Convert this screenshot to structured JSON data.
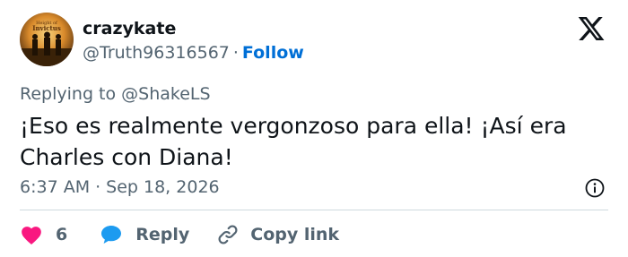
{
  "author": {
    "display_name": "crazykate",
    "handle": "@Truth96316567",
    "separator": "·",
    "follow_label": "Follow",
    "avatar_text": "Height of Invictus"
  },
  "reply_context": "Replying to @ShakeLS",
  "tweet": {
    "text": "¡Eso es realmente vergonzoso para ella! ¡Así era Charles con Diana!",
    "time": "6:37 AM",
    "separator": "·",
    "date": "Sep 18, 2026"
  },
  "actions": {
    "like_count": "6",
    "reply_label": "Reply",
    "copy_label": "Copy link"
  },
  "colors": {
    "text": "#0f1419",
    "secondary": "#536471",
    "follow": "#006fd6",
    "heart": "#f91880",
    "reply_bubble": "#1d9bf0",
    "divider": "#cfd9de"
  },
  "icons": [
    "x-logo-icon",
    "info-icon",
    "heart-icon",
    "reply-bubble-icon",
    "link-icon"
  ]
}
